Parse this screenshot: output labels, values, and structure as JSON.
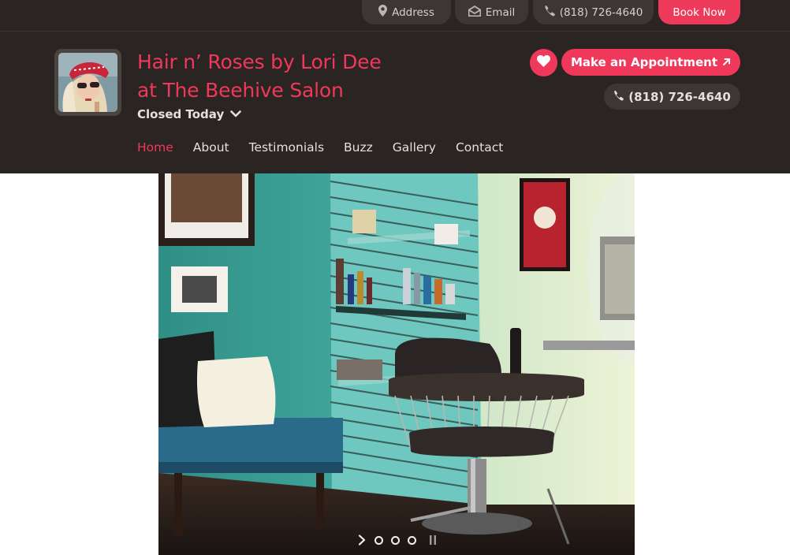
{
  "topbar": {
    "address_label": "Address",
    "email_label": "Email",
    "phone_label": "(818) 726-4640",
    "book_label": "Book Now"
  },
  "header": {
    "name_line1": "Hair n’ Roses by Lori Dee",
    "name_line2": "at The Beehive Salon",
    "hours_status": "Closed Today",
    "appointment_label": "Make an Appointment",
    "phone": "(818) 726-4640"
  },
  "nav": {
    "items": [
      "Home",
      "About",
      "Testimonials",
      "Buzz",
      "Gallery",
      "Contact"
    ],
    "active": "Home"
  },
  "slideshow": {
    "slide_count": 3,
    "current": 1
  },
  "colors": {
    "brand": "#f0385b",
    "dark": "#2a2422",
    "pill": "#3d3634"
  },
  "icons": [
    "map-pin-icon",
    "envelope-icon",
    "phone-icon",
    "chevron-down-icon",
    "heart-icon",
    "external-arrow-icon",
    "next-arrow-icon",
    "pause-icon"
  ]
}
